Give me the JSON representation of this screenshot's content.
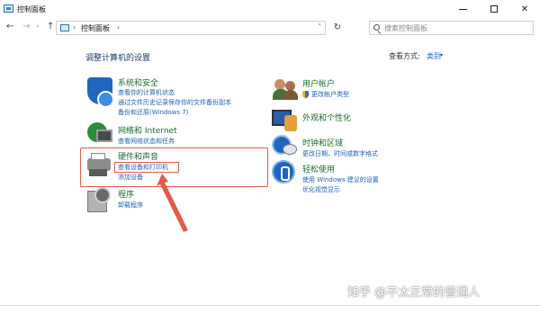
{
  "window": {
    "title": "控制面板",
    "min_glyph": "",
    "max_glyph": "",
    "close_glyph": "✕"
  },
  "nav": {
    "back_glyph": "←",
    "forward_glyph": "→",
    "dropdown_glyph": "˅",
    "up_glyph": "↑",
    "address_sep": "›",
    "address_path": "控制面板",
    "address_dropdown": "˅",
    "refresh_glyph": "↻",
    "search_placeholder": "搜索控制面板"
  },
  "main": {
    "heading": "调整计算机的设置",
    "view_by_label": "查看方式:",
    "view_by_value": "类别",
    "view_by_dropdown": "▾"
  },
  "categories": {
    "system_security": {
      "title": "系统和安全",
      "links": [
        "查看你的计算机状态",
        "通过文件历史记录保存你的文件备份副本",
        "备份和还原(Windows 7)"
      ]
    },
    "network": {
      "title": "网络和 Internet",
      "links": [
        "查看网络状态和任务"
      ]
    },
    "hardware": {
      "title": "硬件和声音",
      "links": [
        "查看设备和打印机",
        "添加设备"
      ]
    },
    "programs": {
      "title": "程序",
      "links": [
        "卸载程序"
      ]
    },
    "user_accounts": {
      "title": "用户帐户",
      "links": [
        "更改帐户类型"
      ]
    },
    "appearance": {
      "title": "外观和个性化"
    },
    "clock_region": {
      "title": "时钟和区域",
      "links": [
        "更改日期、时间或数字格式"
      ]
    },
    "ease_of_access": {
      "title": "轻松使用",
      "links": [
        "使用 Windows 建议的设置",
        "优化视觉显示"
      ]
    }
  },
  "watermark": "知乎 @不太正常的普通人",
  "colors": {
    "title_green": "#1b6c2e",
    "link_blue": "#1f5fb4",
    "highlight_red": "#e25a4a"
  }
}
